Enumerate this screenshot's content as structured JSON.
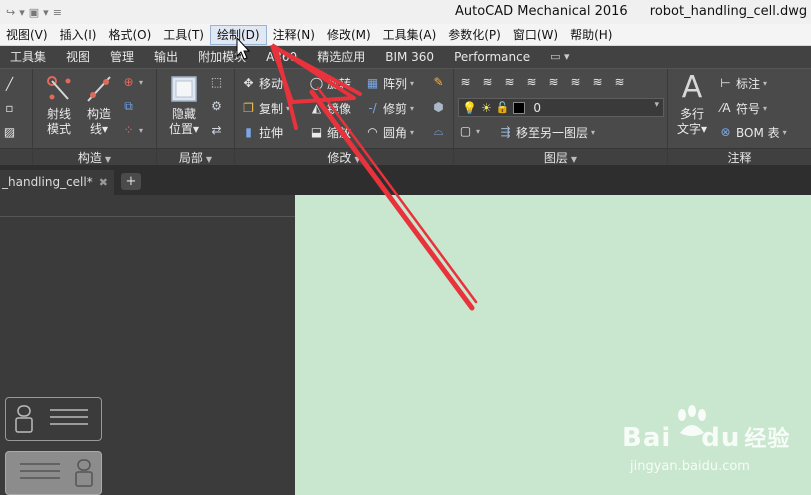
{
  "window": {
    "app_title": "AutoCAD Mechanical 2016",
    "file_title": "robot_handling_cell.dwg"
  },
  "menubar": {
    "items": [
      "视图(V)",
      "插入(I)",
      "格式(O)",
      "工具(T)",
      "绘制(D)",
      "注释(N)",
      "修改(M)",
      "工具集(A)",
      "参数化(P)",
      "窗口(W)",
      "帮助(H)"
    ],
    "active_index": 4
  },
  "ribbon_tabs": [
    "工具集",
    "视图",
    "管理",
    "输出",
    "附加模块",
    "A360",
    "精选应用",
    "BIM 360",
    "Performance"
  ],
  "ribbon": {
    "panels": {
      "construction": "构造",
      "local": "局部",
      "modify": "修改",
      "layers": "图层",
      "annotation": "注释"
    },
    "construction": {
      "ray": "射线\n模式",
      "ray_l1": "射线",
      "ray_l2": "模式",
      "xline_l1": "构造",
      "xline_l2": "线"
    },
    "local": {
      "hide_l1": "隐藏",
      "hide_l2": "位置"
    },
    "modify": {
      "move": "移动",
      "rotate": "旋转",
      "array": "阵列",
      "copy": "复制",
      "mirror": "镜像",
      "trim": "修剪",
      "stretch": "拉伸",
      "scale": "缩放",
      "fillet": "圆角"
    },
    "layers": {
      "current_layer": "0",
      "move_to_layer": "移至另一图层"
    },
    "annotation": {
      "mtext_l1": "多行",
      "mtext_l2": "文字",
      "dimension": "标注",
      "symbol": "符号",
      "bom": "BOM 表"
    }
  },
  "file_tab": {
    "label": "_handling_cell*",
    "close": "✖",
    "add": "+"
  },
  "watermark": {
    "brand": "Bai",
    "brand2": "du",
    "brand_cn": "经验",
    "url": "jingyan.baidu.com"
  },
  "colors": {
    "canvas": "#c9e6ce",
    "ribbon": "#4a4a4a",
    "arrow": "#e8323c",
    "menu_active": "#dfe8f3"
  }
}
